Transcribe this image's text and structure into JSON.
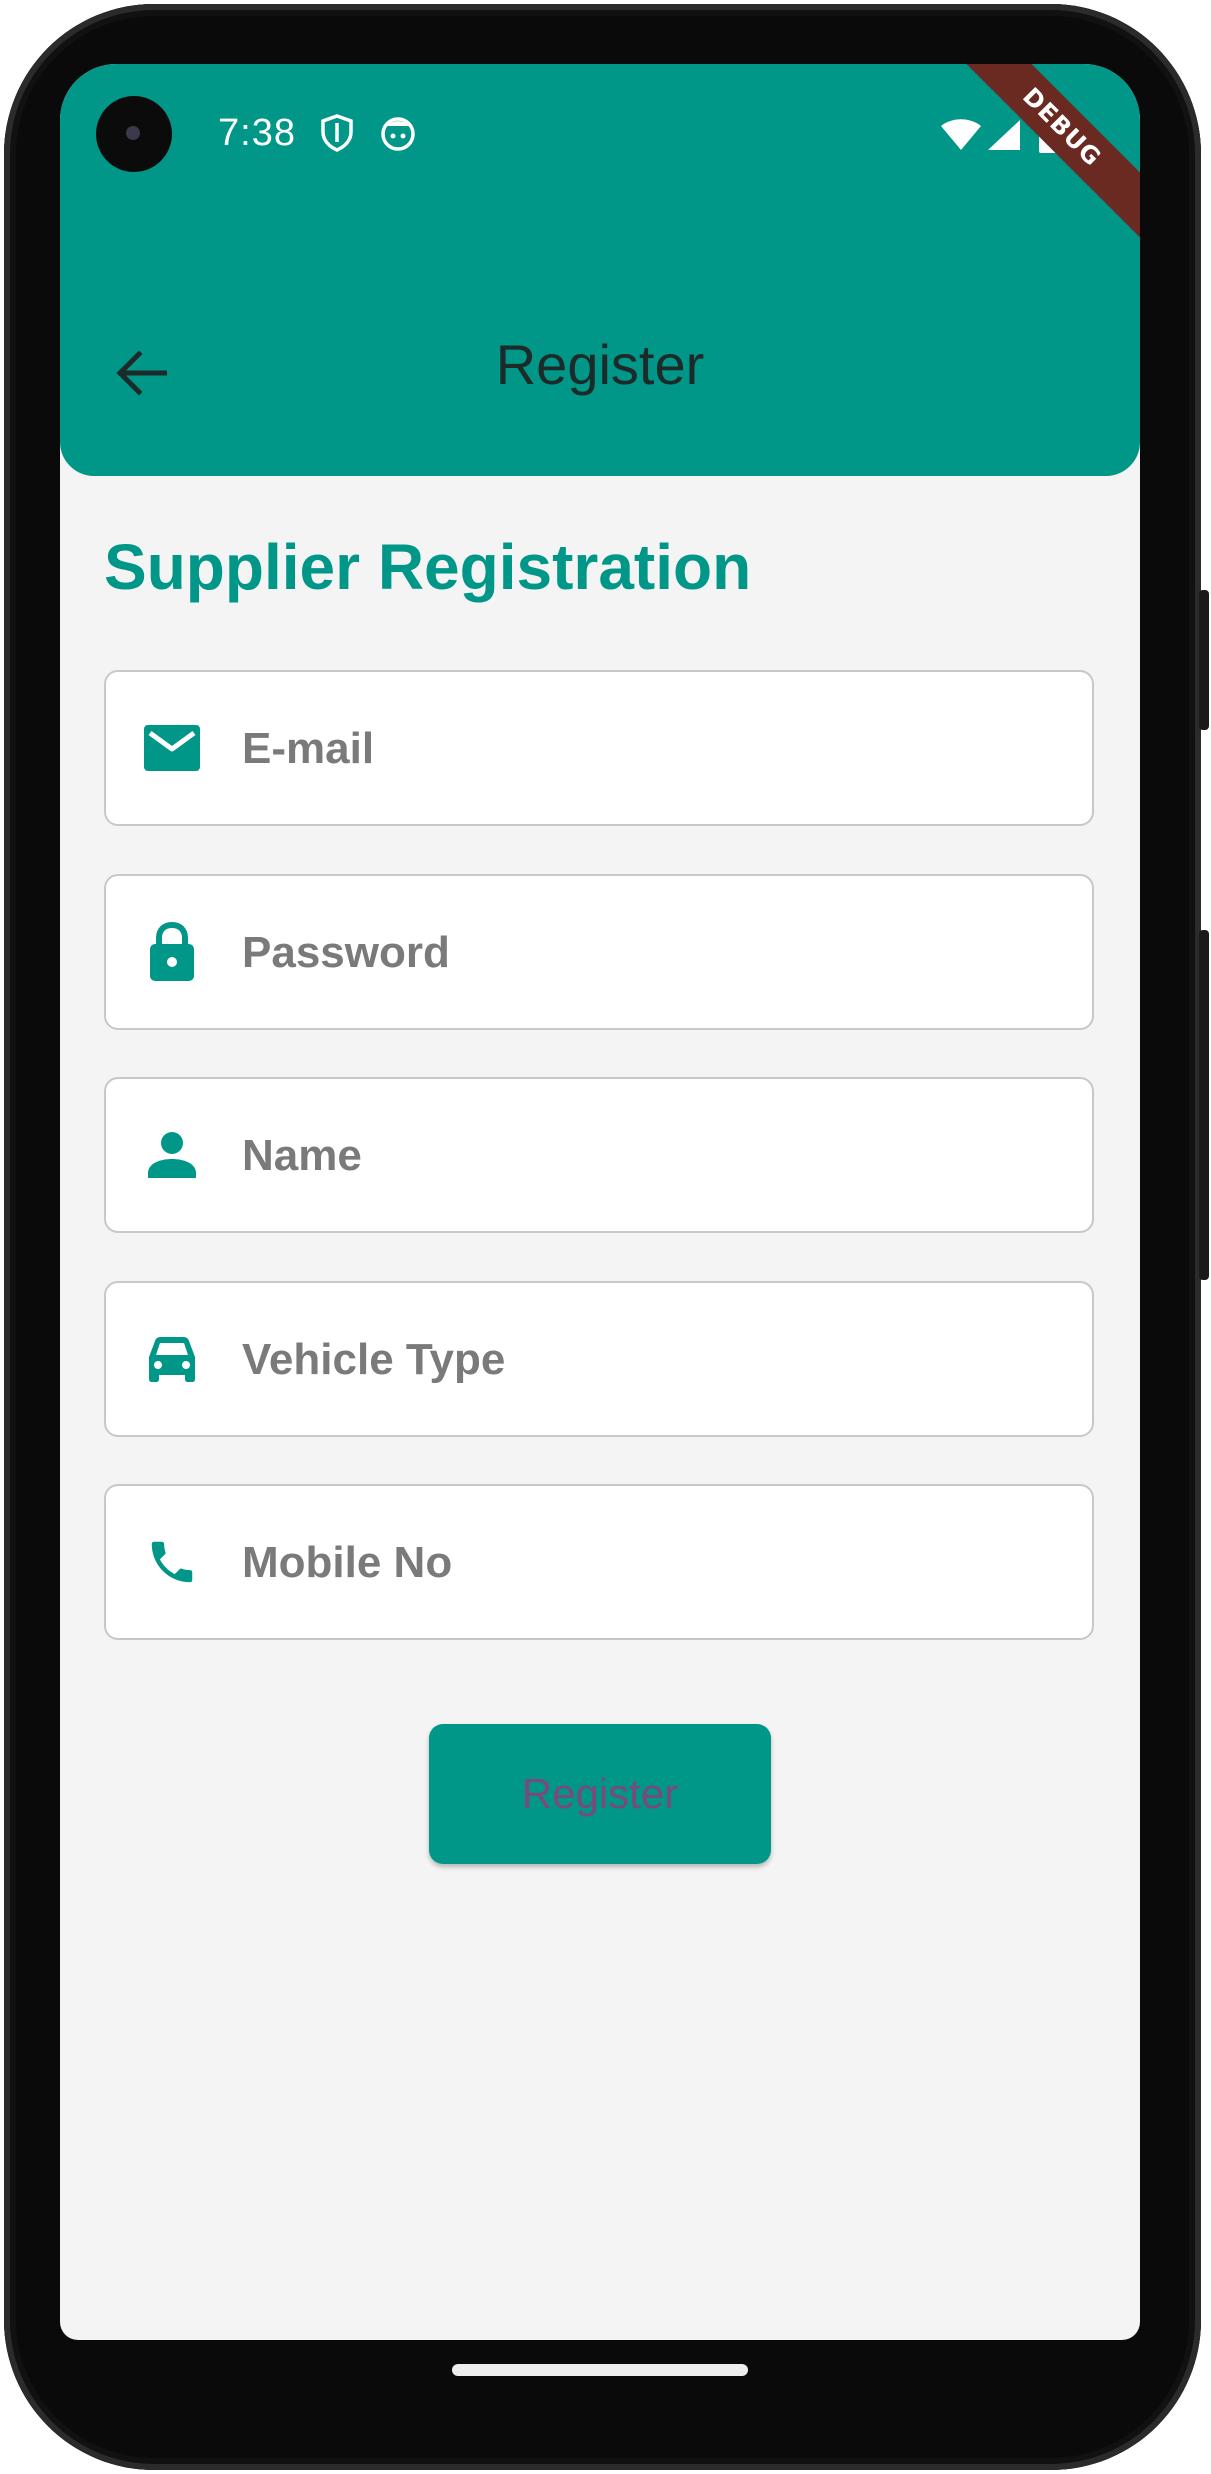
{
  "status_bar": {
    "time": "7:38",
    "left_icons": [
      "shield-icon",
      "face-icon"
    ],
    "right_icons": [
      "wifi-icon",
      "signal-icon",
      "battery-icon"
    ]
  },
  "debug_banner": "DEBUG",
  "appbar": {
    "title": "Register",
    "back_icon": "arrow-back-icon",
    "color": "#009688"
  },
  "heading": "Supplier Registration",
  "fields": [
    {
      "placeholder": "E-mail",
      "icon": "mail-icon"
    },
    {
      "placeholder": "Password",
      "icon": "lock-icon"
    },
    {
      "placeholder": "Name",
      "icon": "person-icon"
    },
    {
      "placeholder": "Vehicle Type",
      "icon": "car-icon"
    },
    {
      "placeholder": "Mobile No",
      "icon": "phone-icon"
    }
  ],
  "register_button": "Register",
  "colors": {
    "primary": "#009688",
    "background": "#f4f4f4",
    "button_text": "#7a4a7a",
    "debug": "#6a2a22"
  }
}
